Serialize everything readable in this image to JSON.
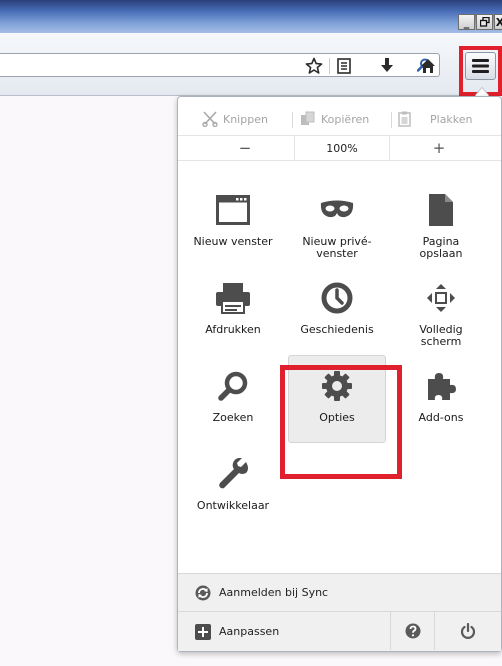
{
  "window": {
    "buttons": {
      "minimize": "_",
      "restore": "🗗",
      "close": "X"
    }
  },
  "toolbar": {
    "icons": [
      "search-icon",
      "bookmark-star-icon",
      "bookmarks-list-icon",
      "download-icon",
      "home-icon",
      "hamburger-menu-icon"
    ]
  },
  "panel": {
    "edit": {
      "cut": "Knippen",
      "copy": "Kopiëren",
      "paste": "Plakken"
    },
    "zoom": {
      "out": "−",
      "level": "100%",
      "in": "+"
    },
    "items": [
      {
        "label": "Nieuw venster",
        "icon": "new-window-icon"
      },
      {
        "label": "Nieuw privé-venster",
        "icon": "private-mask-icon"
      },
      {
        "label": "Pagina opslaan",
        "icon": "save-page-icon"
      },
      {
        "label": "Afdrukken",
        "icon": "printer-icon"
      },
      {
        "label": "Geschiedenis",
        "icon": "clock-icon"
      },
      {
        "label": "Volledig scherm",
        "icon": "fullscreen-icon"
      },
      {
        "label": "Zoeken",
        "icon": "search-icon"
      },
      {
        "label": "Opties",
        "icon": "gear-icon"
      },
      {
        "label": "Add-ons",
        "icon": "puzzle-icon"
      },
      {
        "label": "Ontwikkelaar",
        "icon": "wrench-icon"
      }
    ],
    "sync": {
      "label": "Aanmelden bij Sync"
    },
    "customize": {
      "label": "Aanpassen"
    }
  },
  "colors": {
    "highlight": "#e0202d",
    "titlebar": "#4a6fb8"
  }
}
